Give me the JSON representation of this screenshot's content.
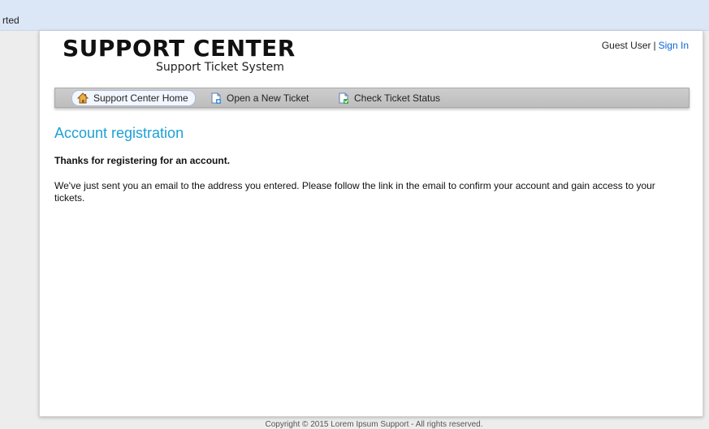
{
  "browser": {
    "bookmark_label": "rted"
  },
  "header": {
    "logo_title": "SUPPORT CENTER",
    "logo_subtitle": "Support Ticket System",
    "user_label": "Guest User",
    "separator": "|",
    "sign_in_label": "Sign In"
  },
  "nav": {
    "items": [
      {
        "label": "Support Center Home",
        "icon": "home-icon",
        "active": true
      },
      {
        "label": "Open a New Ticket",
        "icon": "new-ticket-icon",
        "active": false
      },
      {
        "label": "Check Ticket Status",
        "icon": "ticket-status-icon",
        "active": false
      }
    ]
  },
  "content": {
    "heading": "Account registration",
    "thanks": "Thanks for registering for an account.",
    "message": "We've just sent you an email to the address you entered. Please follow the link in the email to confirm your account and gain access to your tickets."
  },
  "footer": {
    "text": "Copyright © 2015 Lorem Ipsum Support - All rights reserved."
  },
  "colors": {
    "heading": "#1ea0d6",
    "link": "#0a66d6",
    "browser_bar": "#dbe6f7",
    "nav_bar": "#c6c6c6"
  }
}
